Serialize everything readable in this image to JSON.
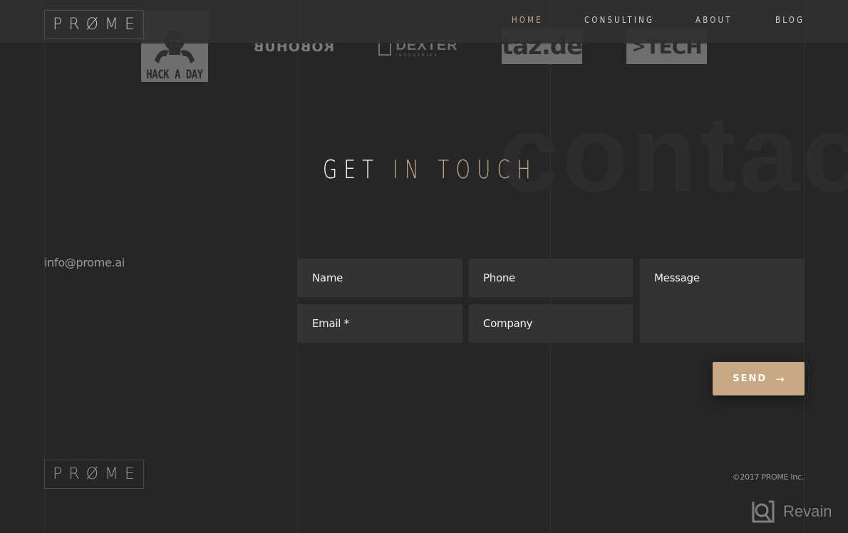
{
  "header": {
    "brand": "PRØME",
    "nav": [
      {
        "label": "HOME",
        "active": true
      },
      {
        "label": "CONSULTING",
        "active": false
      },
      {
        "label": "ABOUT",
        "active": false
      },
      {
        "label": "BLOG",
        "active": false
      }
    ]
  },
  "press_logos": [
    {
      "name": "Hack A Day",
      "text": "HACK A DAY",
      "icon": "skull-wrenches-icon"
    },
    {
      "name": "Robohub",
      "text": "ROBOHUB"
    },
    {
      "name": "Dexter Industries",
      "text": "DEXTER",
      "subtext": "INDUSTRIES"
    },
    {
      "name": "taz.de",
      "text": "taz.de"
    },
    {
      "name": "Tech",
      "text": "TECH",
      "icon": "chevron-right-icon"
    }
  ],
  "contact": {
    "background_word": "contact",
    "heading_part1": "GET",
    "heading_part2": "IN TOUCH",
    "email": "info@prome.ai",
    "form": {
      "name_placeholder": "Name",
      "phone_placeholder": "Phone",
      "email_placeholder": "Email *",
      "company_placeholder": "Company",
      "message_placeholder": "Message",
      "send_label": "SEND",
      "send_icon": "arrow-right-icon"
    }
  },
  "footer": {
    "brand": "PRØME",
    "copyright": "©2017 PROME Inc."
  },
  "watermark": {
    "label": "Revain"
  },
  "colors": {
    "accent": "#c8a784",
    "background": "#262626",
    "field": "#333333",
    "header": "#303030"
  }
}
